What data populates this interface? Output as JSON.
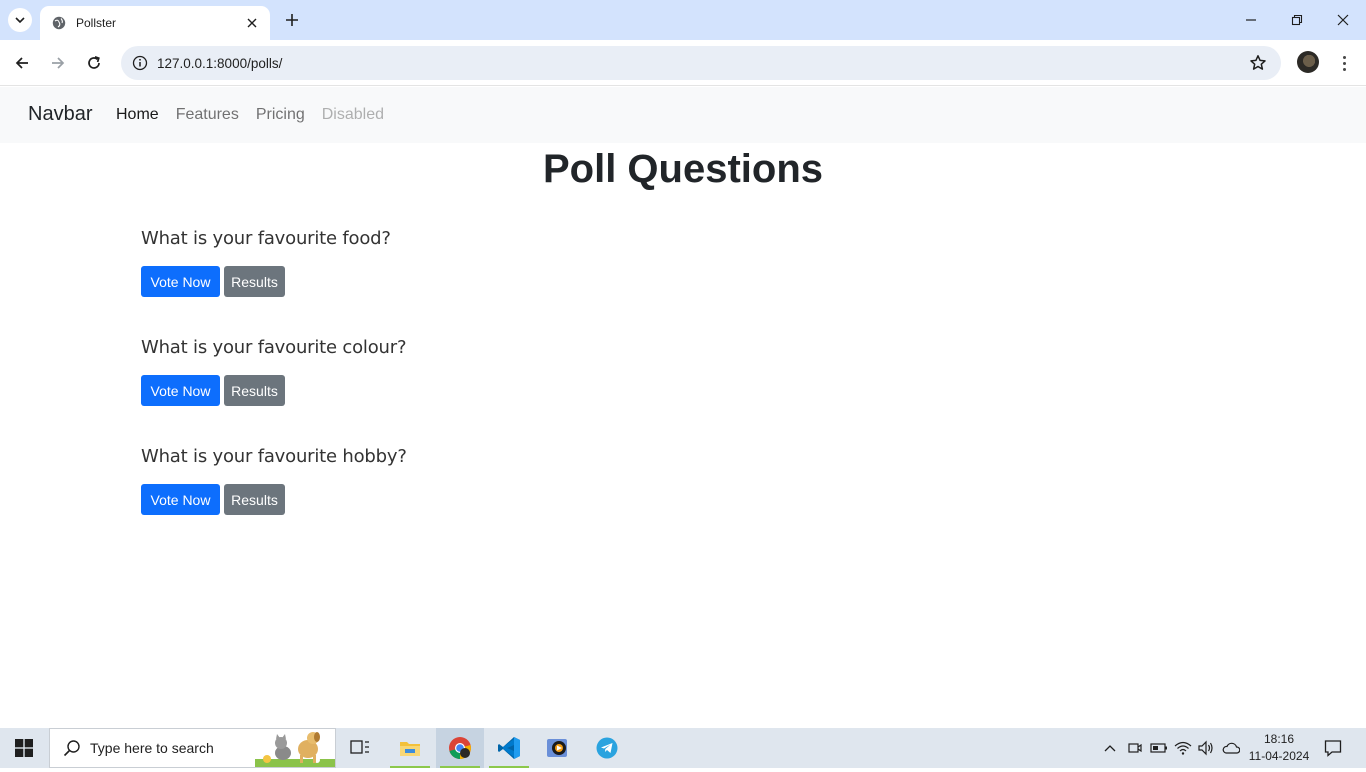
{
  "browser": {
    "tab_title": "Pollster",
    "url": "127.0.0.1:8000/polls/"
  },
  "navbar": {
    "brand": "Navbar",
    "links": [
      {
        "label": "Home",
        "state": "active"
      },
      {
        "label": "Features",
        "state": "normal"
      },
      {
        "label": "Pricing",
        "state": "normal"
      },
      {
        "label": "Disabled",
        "state": "disabled"
      }
    ]
  },
  "page": {
    "title": "Poll Questions",
    "polls": [
      {
        "question": "What is your favourite food?",
        "vote_label": "Vote Now",
        "results_label": "Results"
      },
      {
        "question": "What is your favourite colour?",
        "vote_label": "Vote Now",
        "results_label": "Results"
      },
      {
        "question": "What is your favourite hobby?",
        "vote_label": "Vote Now",
        "results_label": "Results"
      }
    ]
  },
  "taskbar": {
    "search_placeholder": "Type here to search",
    "time": "18:16",
    "date": "11-04-2024",
    "apps": [
      "task-view-icon",
      "file-explorer-icon",
      "chrome-icon",
      "vscode-icon",
      "media-player-icon",
      "telegram-icon"
    ]
  },
  "colors": {
    "primary": "#0d6efd",
    "secondary": "#6c757d",
    "tabstrip": "#d3e3fd",
    "navbar_bg": "#f8f9fa"
  }
}
